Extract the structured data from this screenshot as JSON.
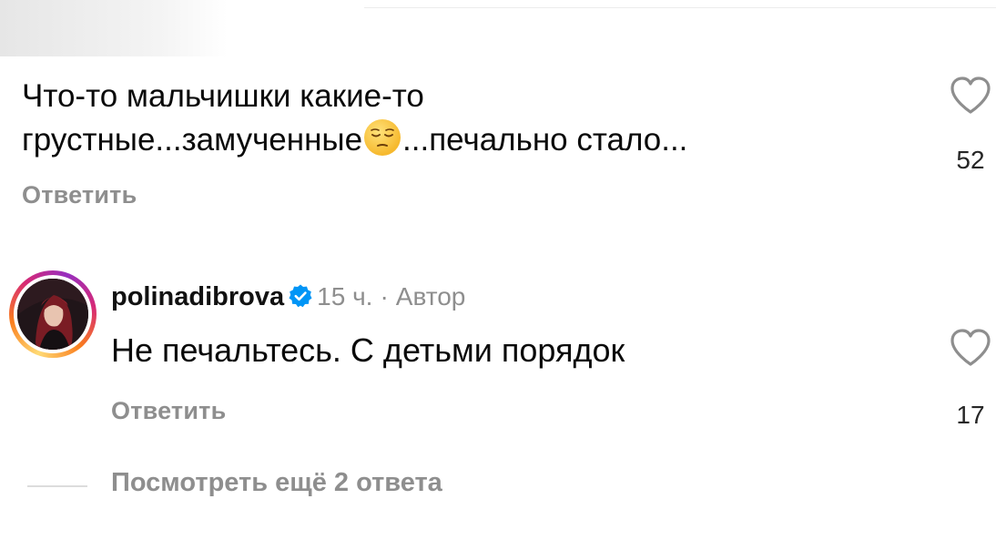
{
  "comment1": {
    "text_line1": "Что-то мальчишки какие-то",
    "text_before_emoji": "грустные...замученные",
    "emoji": "pensive-face",
    "text_after_emoji": "...печально стало...",
    "reply_label": "Ответить",
    "like_count": "52"
  },
  "comment2": {
    "username": "polinadibrova",
    "verified": true,
    "time": "15 ч.",
    "separator": "·",
    "author_label": "Автор",
    "text": "Не печальтесь. С детьми порядок",
    "reply_label": "Ответить",
    "like_count": "17",
    "view_replies_label": "Посмотреть ещё 2 ответа"
  },
  "colors": {
    "secondary_text": "#8e8e8e",
    "verified_blue": "#0095f6",
    "story_ring": [
      "#feda75",
      "#fa7e1e",
      "#d62976",
      "#962fbf"
    ]
  }
}
